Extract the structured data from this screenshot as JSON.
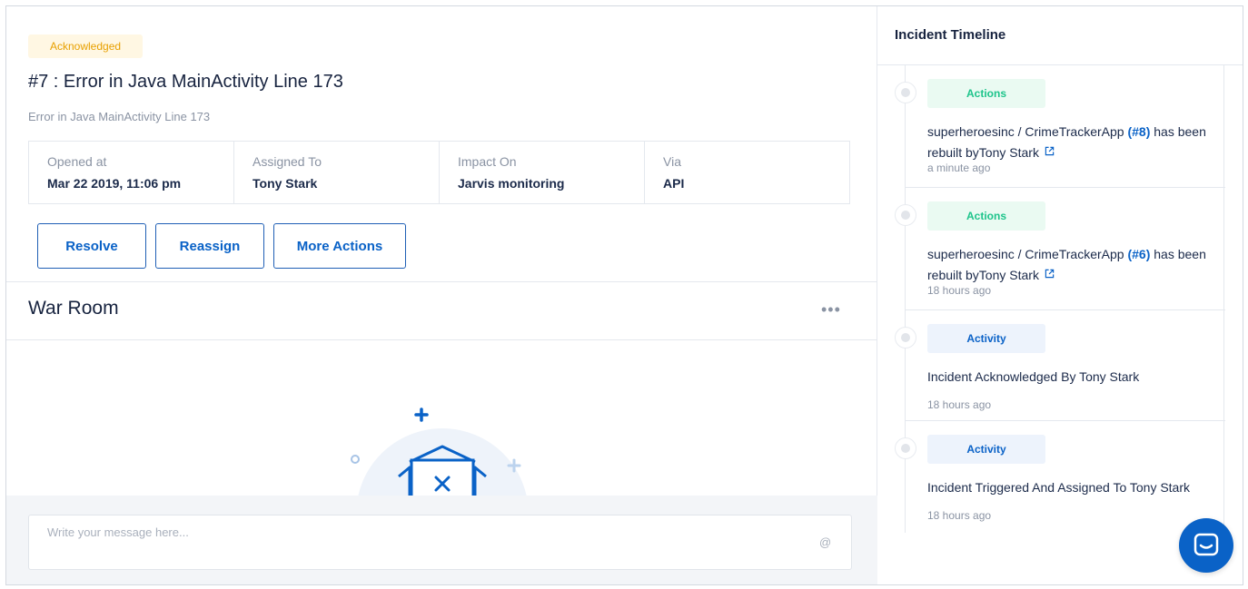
{
  "incident": {
    "status": "Acknowledged",
    "title": "#7 : Error in Java MainActivity Line 173",
    "subtitle": "Error in Java MainActivity Line 173",
    "meta": [
      {
        "label": "Opened at",
        "value": "Mar 22 2019, 11:06 pm"
      },
      {
        "label": "Assigned To",
        "value": "Tony Stark"
      },
      {
        "label": "Impact On",
        "value": "Jarvis monitoring"
      },
      {
        "label": "Via",
        "value": "API"
      }
    ],
    "buttons": {
      "resolve": "Resolve",
      "reassign": "Reassign",
      "more": "More Actions"
    }
  },
  "war_room": {
    "title": "War Room",
    "menu_icon": "more-horizontal-icon",
    "menu_glyph": "•••",
    "composer_placeholder": "Write your message here...",
    "at_glyph": "@",
    "empty_icon": "empty-mailbox-icon"
  },
  "timeline": {
    "title": "Incident Timeline",
    "items": [
      {
        "tag": "Actions",
        "text_pre": "superheroesinc / CrimeTrackerApp ",
        "link": "(#8)",
        "text_mid": " has been rebuilt byTony Stark",
        "time": "a minute ago"
      },
      {
        "tag": "Actions",
        "text_pre": "superheroesinc / CrimeTrackerApp ",
        "link": "(#6)",
        "text_mid": " has been rebuilt byTony Stark",
        "time": "18 hours ago"
      },
      {
        "tag": "Activity",
        "text": "Incident Acknowledged By Tony Stark",
        "time": "18 hours ago"
      },
      {
        "tag": "Activity",
        "text": "Incident Triggered And Assigned To Tony Stark",
        "time": "18 hours ago"
      }
    ]
  },
  "colors": {
    "accent": "#0a62c7",
    "acknowledged_text": "#e8a000",
    "acknowledged_bg": "#fff7e3",
    "actions_tag_text": "#1ec48b",
    "actions_tag_bg": "#eafaf2",
    "activity_tag_bg": "#edf3fc"
  },
  "chat_launcher_icon": "chat-icon"
}
